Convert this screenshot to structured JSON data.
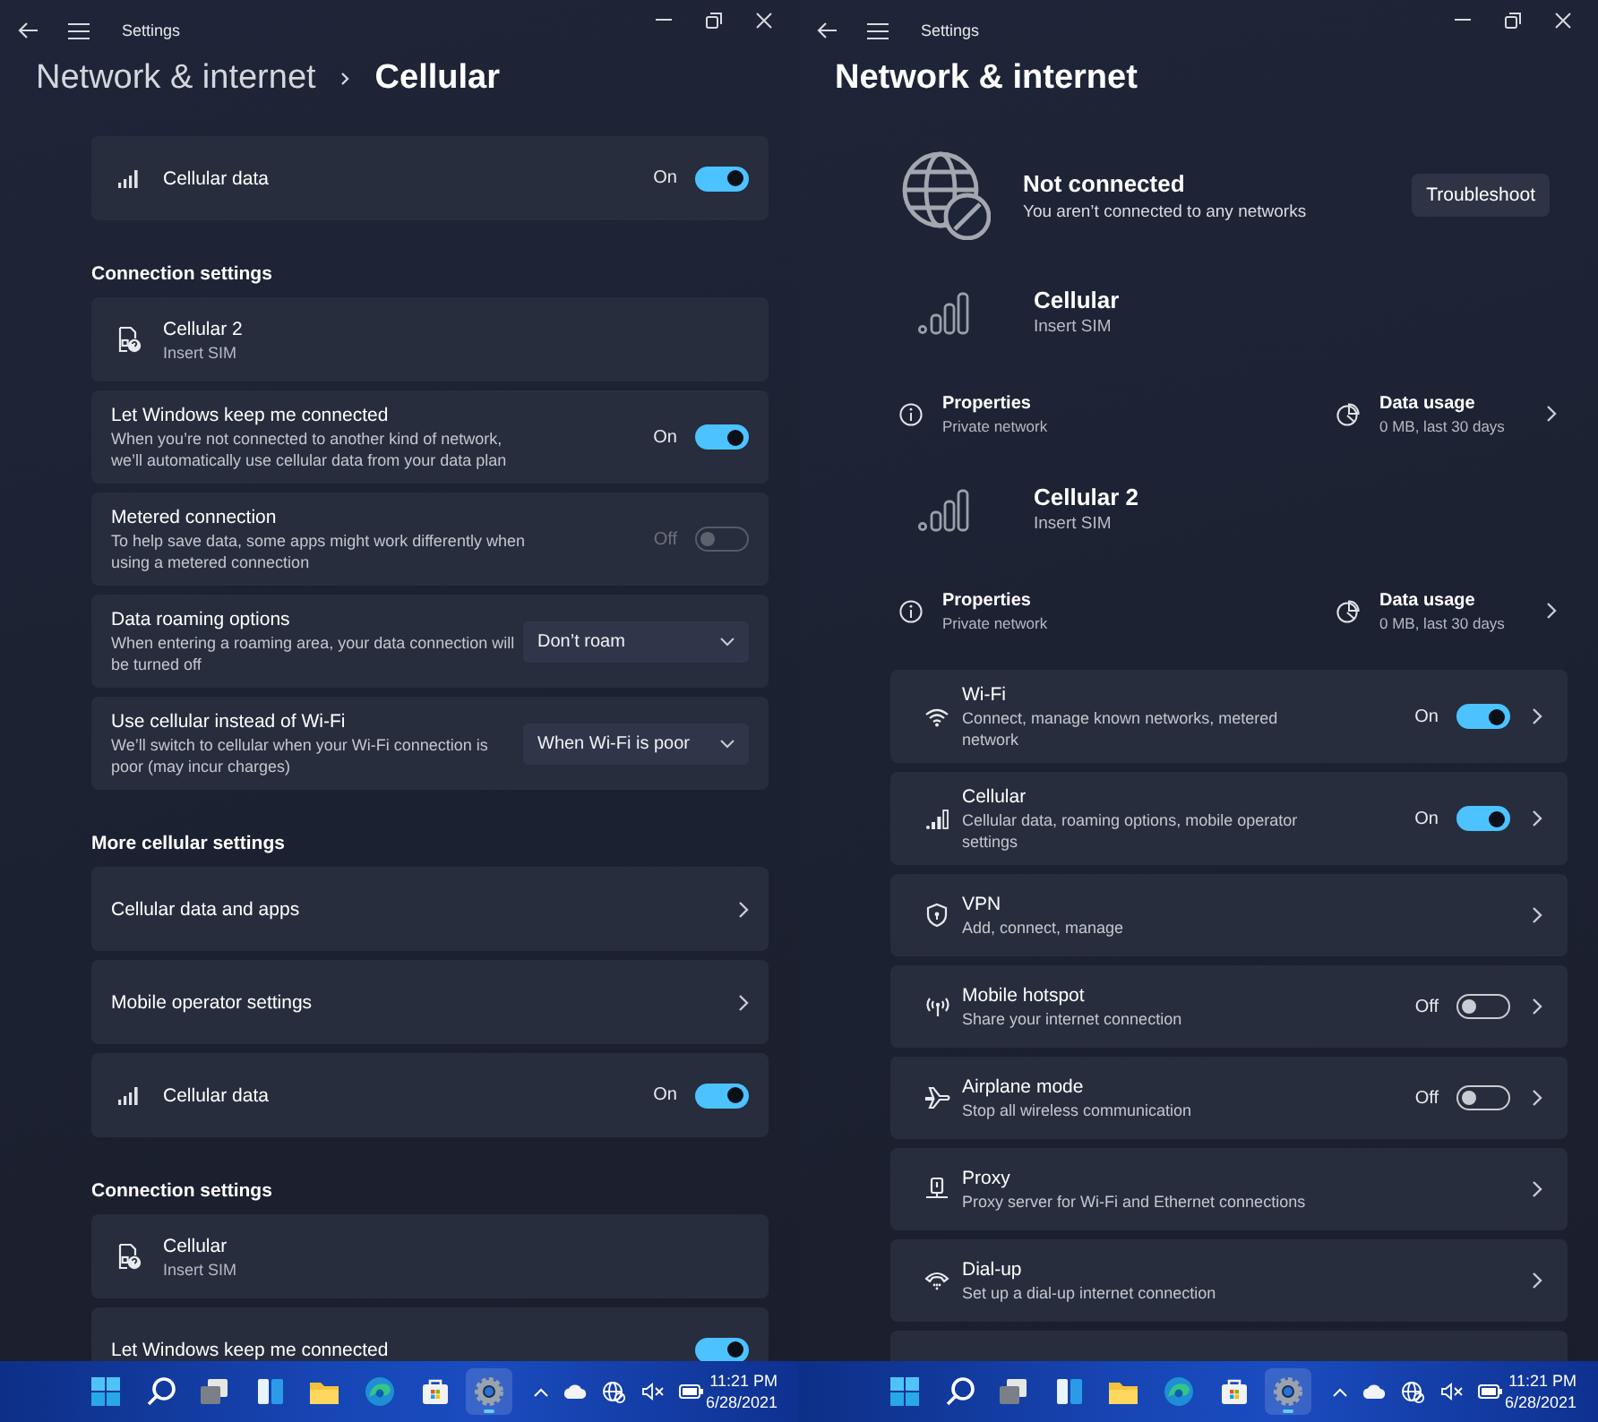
{
  "cellular_window": {
    "app_title": "Settings",
    "breadcrumb": [
      "Network & internet",
      "Cellular"
    ],
    "blocks": [
      {
        "kind": "signal_toggle",
        "title": "Cellular data",
        "state_label": "On",
        "on": true
      },
      {
        "kind": "heading",
        "title": "Connection settings"
      },
      {
        "kind": "sim",
        "title": "Cellular 2",
        "subtitle": "Insert SIM"
      },
      {
        "kind": "toggle",
        "title": "Let Windows keep me connected",
        "description": "When you’re not connected to another kind of network, we’ll automatically use cellular data from your data plan",
        "state_label": "On",
        "on": true,
        "disabled": false
      },
      {
        "kind": "toggle",
        "title": "Metered connection",
        "description": "To help save data, some apps might work differently when using a metered connection",
        "state_label": "Off",
        "on": false,
        "disabled": true
      },
      {
        "kind": "dropdown",
        "title": "Data roaming options",
        "description": "When entering a roaming area, your data connection will be turned off",
        "value": "Don’t roam"
      },
      {
        "kind": "dropdown",
        "title": "Use cellular instead of Wi-Fi",
        "description": "We’ll switch to cellular when your Wi-Fi connection is poor (may incur charges)",
        "value": "When Wi-Fi is poor"
      },
      {
        "kind": "heading",
        "title": "More cellular settings"
      },
      {
        "kind": "link",
        "title": "Cellular data and apps"
      },
      {
        "kind": "link",
        "title": "Mobile operator settings"
      },
      {
        "kind": "signal_toggle",
        "title": "Cellular data",
        "state_label": "On",
        "on": true
      },
      {
        "kind": "heading",
        "title": "Connection settings"
      },
      {
        "kind": "sim",
        "title": "Cellular",
        "subtitle": "Insert SIM"
      },
      {
        "kind": "toggle",
        "title": "Let Windows keep me connected",
        "on": true,
        "disabled": false
      }
    ],
    "taskbar": {
      "apps": [
        {
          "kind": "start",
          "selected": false
        },
        {
          "kind": "search",
          "selected": false
        },
        {
          "kind": "task_view",
          "selected": false
        },
        {
          "kind": "widgets",
          "selected": false
        },
        {
          "kind": "explorer",
          "selected": false
        },
        {
          "kind": "edge",
          "selected": false
        },
        {
          "kind": "store",
          "selected": false
        },
        {
          "kind": "settings",
          "selected": true
        }
      ],
      "time": "11:21 PM",
      "date": "6/28/2021"
    }
  },
  "network_window": {
    "app_title": "Settings",
    "title": "Network & internet",
    "status": {
      "title": "Not connected",
      "message": "You aren’t connected to any networks",
      "button": "Troubleshoot"
    },
    "connections": [
      {
        "name": "Cellular",
        "status": "Insert SIM",
        "properties": {
          "label": "Properties",
          "value": "Private network"
        },
        "usage": {
          "label": "Data usage",
          "value": "0 MB, last 30 days"
        }
      },
      {
        "name": "Cellular 2",
        "status": "Insert SIM",
        "properties": {
          "label": "Properties",
          "value": "Private network"
        },
        "usage": {
          "label": "Data usage",
          "value": "0 MB, last 30 days"
        }
      }
    ],
    "settings": [
      {
        "kind": "wifi",
        "title": "Wi-Fi",
        "description": "Connect, manage known networks, metered network",
        "state_label": "On",
        "on": true
      },
      {
        "kind": "cellular",
        "title": "Cellular",
        "description": "Cellular data, roaming options, mobile operator settings",
        "state_label": "On",
        "on": true
      },
      {
        "kind": "vpn",
        "title": "VPN",
        "description": "Add, connect, manage"
      },
      {
        "kind": "hotspot",
        "title": "Mobile hotspot",
        "description": "Share your internet connection",
        "state_label": "Off",
        "on": false
      },
      {
        "kind": "airplane",
        "title": "Airplane mode",
        "description": "Stop all wireless communication",
        "state_label": "Off",
        "on": false
      },
      {
        "kind": "proxy",
        "title": "Proxy",
        "description": "Proxy server for Wi-Fi and Ethernet connections"
      },
      {
        "kind": "dialup",
        "title": "Dial-up",
        "description": "Set up a dial-up internet connection"
      },
      {
        "kind": "advanced"
      }
    ],
    "taskbar": {
      "apps": [
        {
          "kind": "start",
          "selected": false
        },
        {
          "kind": "search",
          "selected": false
        },
        {
          "kind": "task_view",
          "selected": false
        },
        {
          "kind": "widgets",
          "selected": false
        },
        {
          "kind": "explorer",
          "selected": false
        },
        {
          "kind": "edge",
          "selected": false
        },
        {
          "kind": "store",
          "selected": false
        },
        {
          "kind": "settings",
          "selected": true
        }
      ],
      "time": "11:21 PM",
      "date": "6/28/2021"
    }
  }
}
